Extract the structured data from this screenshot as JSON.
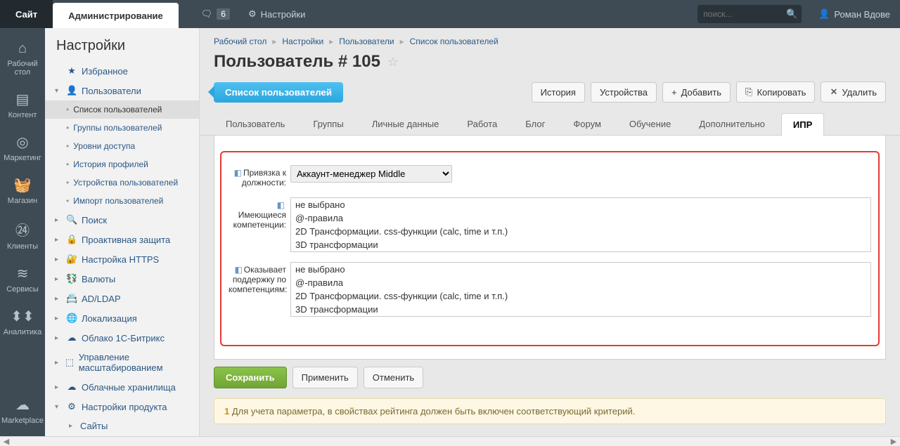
{
  "topbar": {
    "site_tab": "Сайт",
    "admin_tab": "Администрирование",
    "notif_count": "6",
    "settings_label": "Настройки",
    "search_placeholder": "поиск...",
    "user_name": "Роман Вдове"
  },
  "left_icons": [
    {
      "icon": "⌂",
      "label": "Рабочий стол"
    },
    {
      "icon": "▤",
      "label": "Контент"
    },
    {
      "icon": "◎",
      "label": "Маркетинг"
    },
    {
      "icon": "🧺",
      "label": "Магазин"
    },
    {
      "icon": "㉔",
      "label": "Клиенты"
    },
    {
      "icon": "≋",
      "label": "Сервисы"
    },
    {
      "icon": "⬍⬍",
      "label": "Аналитика"
    },
    {
      "icon": "☁",
      "label": "Marketplace"
    }
  ],
  "sidepanel_title": "Настройки",
  "tree": [
    {
      "type": "top",
      "arrow": "",
      "icon": "★",
      "label": "Избранное",
      "cls": "fav"
    },
    {
      "type": "top",
      "arrow": "▾",
      "icon": "👤",
      "label": "Пользователи"
    },
    {
      "type": "sub",
      "label": "Список пользователей",
      "sel": true
    },
    {
      "type": "sub",
      "label": "Группы пользователей"
    },
    {
      "type": "sub",
      "label": "Уровни доступа"
    },
    {
      "type": "sub",
      "label": "История профилей"
    },
    {
      "type": "sub",
      "label": "Устройства пользователей"
    },
    {
      "type": "sub",
      "label": "Импорт пользователей"
    },
    {
      "type": "top",
      "arrow": "▸",
      "icon": "🔍",
      "label": "Поиск"
    },
    {
      "type": "top",
      "arrow": "▸",
      "icon": "🔒",
      "label": "Проактивная защита"
    },
    {
      "type": "top",
      "arrow": "▸",
      "icon": "🔐",
      "label": "Настройка HTTPS"
    },
    {
      "type": "top",
      "arrow": "▸",
      "icon": "💱",
      "label": "Валюты"
    },
    {
      "type": "top",
      "arrow": "▸",
      "icon": "📇",
      "label": "AD/LDAP"
    },
    {
      "type": "top",
      "arrow": "▸",
      "icon": "🌐",
      "label": "Локализация"
    },
    {
      "type": "top",
      "arrow": "▸",
      "icon": "☁",
      "label": "Облако 1С-Битрикс"
    },
    {
      "type": "top",
      "arrow": "▸",
      "icon": "⬚",
      "label": "Управление масштабированием"
    },
    {
      "type": "top",
      "arrow": "▸",
      "icon": "☁",
      "label": "Облачные хранилища"
    },
    {
      "type": "top",
      "arrow": "▾",
      "icon": "⚙",
      "label": "Настройки продукта"
    },
    {
      "type": "sub2",
      "label": "Сайты"
    }
  ],
  "breadcrumbs": [
    "Рабочий стол",
    "Настройки",
    "Пользователи",
    "Список пользователей"
  ],
  "page_title": "Пользователь # 105",
  "toolbar": {
    "list_users": "Список пользователей",
    "history": "История",
    "devices": "Устройства",
    "add": "Добавить",
    "copy": "Копировать",
    "delete": "Удалить"
  },
  "tabs": [
    "Пользователь",
    "Группы",
    "Личные данные",
    "Работа",
    "Блог",
    "Форум",
    "Обучение",
    "Дополнительно",
    "ИПР"
  ],
  "active_tab": "ИПР",
  "form": {
    "position_label": "Привязка к должности:",
    "position_value": "Аккаунт-менеджер Middle",
    "competencies_label": "Имеющиеся компетенции:",
    "support_label": "Оказывает поддержку по компетенциям:",
    "list_options": [
      "не выбрано",
      "@-правила",
      "2D Трансформации. css-функции (calc, time и т.п.)",
      "3D трансформации"
    ]
  },
  "actions": {
    "save": "Сохранить",
    "apply": "Применить",
    "cancel": "Отменить"
  },
  "warning_num": "1",
  "warning_text": "Для учета параметра, в свойствах рейтинга должен быть включен соответствующий критерий."
}
